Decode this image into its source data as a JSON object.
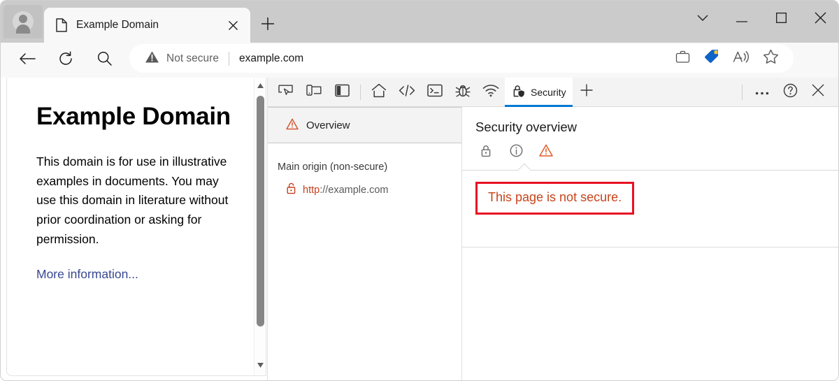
{
  "window": {
    "controls": [
      {
        "name": "tab-actions-menu",
        "label": "⌄",
        "icon": "chevron-down-icon"
      },
      {
        "name": "minimize-button",
        "label": "─",
        "icon": "minimize-icon"
      },
      {
        "name": "maximize-button",
        "label": "□",
        "icon": "maximize-icon"
      },
      {
        "name": "close-button",
        "label": "✕",
        "icon": "close-icon"
      }
    ]
  },
  "tabstrip": {
    "profile_icon": "profile-avatar-icon",
    "active_tab": {
      "title": "Example Domain",
      "favicon": "document-page-icon",
      "close_icon": "close-icon"
    },
    "new_tab_label": "+",
    "new_tab_icon": "plus-icon"
  },
  "toolbar": {
    "back_icon": "back-arrow-icon",
    "refresh_icon": "refresh-icon",
    "search_icon": "search-icon",
    "omnibox": {
      "security_icon": "warning-triangle-filled-icon",
      "security_label": "Not secure",
      "url": "example.com"
    },
    "actions": [
      {
        "name": "collections-button",
        "icon": "briefcase-icon"
      },
      {
        "name": "shopping-button",
        "icon": "price-tag-icon",
        "color": "#0f63c6"
      },
      {
        "name": "read-aloud-button",
        "icon": "read-aloud-icon"
      },
      {
        "name": "favorites-button",
        "icon": "star-icon"
      }
    ],
    "settings_more_icon": "ellipsis-icon"
  },
  "page": {
    "heading": "Example Domain",
    "paragraph": "This domain is for use in illustrative examples in documents. You may use this domain in literature without prior coordination or asking for permission.",
    "link": "More information...",
    "link_color": "#38488f",
    "scrollbar": {
      "up_icon": "scroll-up-arrow-icon",
      "down_icon": "scroll-down-arrow-icon"
    }
  },
  "devtools": {
    "left_tools": [
      {
        "name": "inspect-element-button",
        "icon": "inspect-cursor-icon"
      },
      {
        "name": "device-emulation-button",
        "icon": "device-toggle-icon"
      },
      {
        "name": "dock-side-button",
        "icon": "dock-panel-icon"
      }
    ],
    "tabs": [
      {
        "name": "tab-welcome",
        "icon": "home-icon",
        "label": "",
        "active": false
      },
      {
        "name": "tab-elements",
        "icon": "code-brackets-icon",
        "label": "",
        "active": false
      },
      {
        "name": "tab-console",
        "icon": "console-terminal-icon",
        "label": "",
        "active": false
      },
      {
        "name": "tab-sources",
        "icon": "bug-debugger-icon",
        "label": "",
        "active": false
      },
      {
        "name": "tab-network",
        "icon": "wifi-network-icon",
        "label": "",
        "active": false
      },
      {
        "name": "tab-security",
        "icon": "lock-shield-icon",
        "label": "Security",
        "active": true
      }
    ],
    "add_tab_label": "+",
    "add_tab_icon": "plus-icon",
    "right_tools": [
      {
        "name": "devtools-more-button",
        "icon": "ellipsis-icon"
      },
      {
        "name": "devtools-help-button",
        "icon": "question-circle-icon"
      },
      {
        "name": "devtools-close-button",
        "icon": "close-icon"
      }
    ],
    "accent_color": "#0078d4",
    "sidebar": {
      "overview": {
        "label": "Overview",
        "icon": "warning-triangle-outline-icon"
      },
      "group_title": "Main origin (non-secure)",
      "origin": {
        "url_scheme": "http",
        "url_rest": "://example.com",
        "icon": "unlocked-padlock-icon"
      }
    },
    "main": {
      "title": "Security overview",
      "states": [
        {
          "name": "security-state-lock",
          "icon": "padlock-icon",
          "active": false
        },
        {
          "name": "security-state-info",
          "icon": "info-circle-icon",
          "active": false
        },
        {
          "name": "security-state-warning",
          "icon": "warning-triangle-outline-icon",
          "active": true
        }
      ],
      "alert_text": "This page is not secure.",
      "alert_border_color": "#e81123",
      "alert_text_color": "#c5441b"
    }
  }
}
